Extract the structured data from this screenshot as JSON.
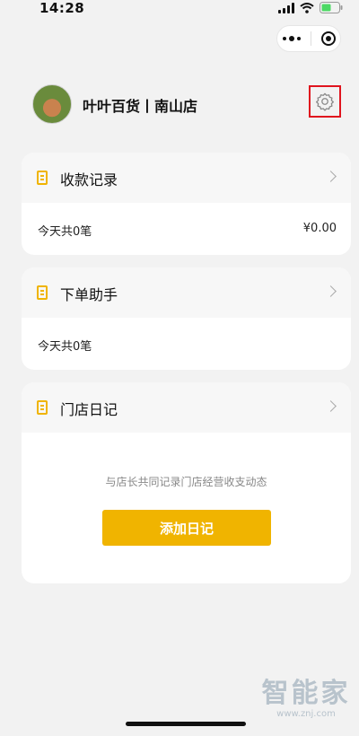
{
  "status_bar": {
    "time": "14:28"
  },
  "header": {
    "store_name": "叶叶百货丨南山店"
  },
  "cards": [
    {
      "title": "收款记录",
      "row_left": "今天共0笔",
      "row_right": "¥0.00"
    },
    {
      "title": "下单助手",
      "row_left": "今天共0笔"
    },
    {
      "title": "门店日记",
      "description": "与店长共同记录门店经营收支动态",
      "button_label": "添加日记"
    }
  ],
  "watermark": {
    "title": "智能家",
    "url": "www.znj.com"
  },
  "colors": {
    "accent": "#f0b400",
    "highlight_box": "#e0141e",
    "background": "#f2f2f2"
  },
  "icons": [
    "signal-icon",
    "wifi-icon",
    "battery-icon",
    "more-icon",
    "target-icon",
    "settings-icon",
    "document-icon",
    "chevron-right-icon"
  ]
}
